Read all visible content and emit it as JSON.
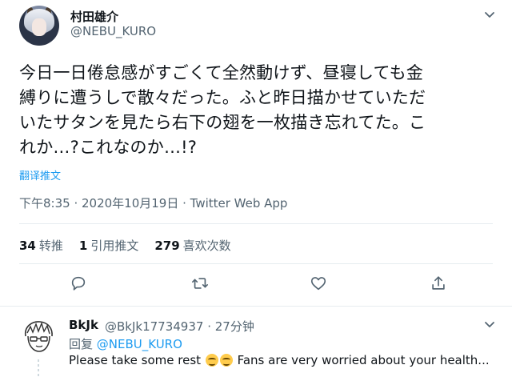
{
  "tweet": {
    "display_name": "村田雄介",
    "handle": "@NEBU_KURO",
    "lines": [
      "今日一日倦怠感がすごくて全然動けず、昼寝しても金",
      "縛りに遭うしで散々だった。ふと昨日描かせていただ",
      "いたサタンを見たら右下の翅を一枚描き忘れてた。こ",
      "れか…?これなのか…!?"
    ],
    "translate_label": "翻译推文",
    "timestamp": "下午8:35 · 2020年10月19日 · Twitter Web App",
    "stats": {
      "retweets_count": "34",
      "retweets_label": "转推",
      "quotes_count": "1",
      "quotes_label": "引用推文",
      "likes_count": "279",
      "likes_label": "喜欢次数"
    },
    "icons": [
      "caret-down-icon",
      "reply-icon",
      "retweet-icon",
      "like-icon",
      "share-icon"
    ]
  },
  "reply": {
    "display_name": "BkJk",
    "handle_time": "@BkJk17734937 · 27分钟",
    "replying_prefix": "回复",
    "replying_mention": "@NEBU_KURO",
    "text_before": "Please take some rest",
    "text_after": "Fans are very worried about your health..."
  },
  "colors": {
    "accent": "#1d9bf0",
    "secondary_text": "#536471",
    "divider": "#e6ecf0"
  }
}
